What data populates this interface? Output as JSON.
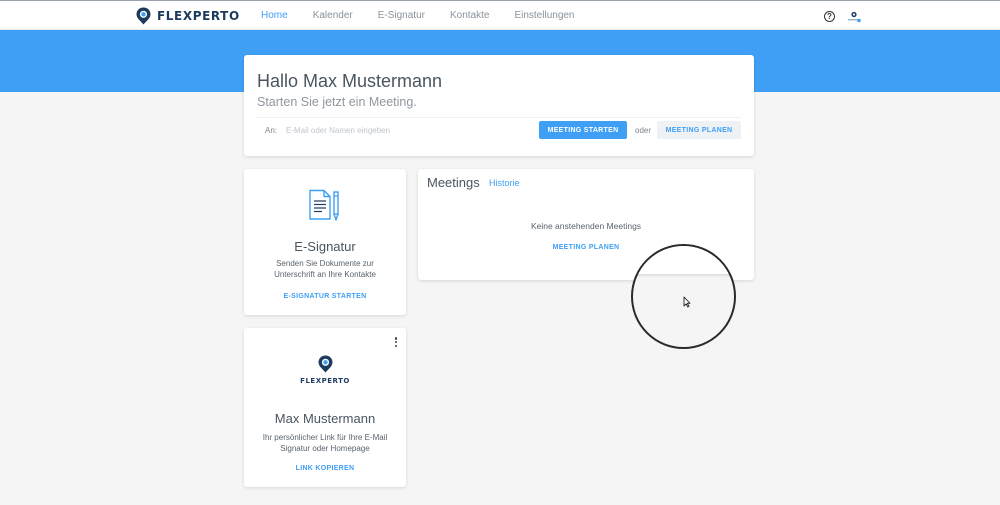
{
  "header": {
    "logo_text": "FLEXPERTO",
    "nav": [
      {
        "label": "Home",
        "active": true
      },
      {
        "label": "Kalender",
        "active": false
      },
      {
        "label": "E-Signatur",
        "active": false
      },
      {
        "label": "Kontakte",
        "active": false
      },
      {
        "label": "Einstellungen",
        "active": false
      }
    ],
    "help_icon": "question-circle-icon",
    "avatar_icon": "user-avatar-icon"
  },
  "welcome": {
    "greeting": "Hallo Max Mustermann",
    "subtitle": "Starten Sie jetzt ein Meeting.",
    "to_label": "An:",
    "input_value": "",
    "input_placeholder": "E-Mail oder Namen eingeben",
    "start_button": "MEETING STARTEN",
    "or_label": "oder",
    "plan_button": "MEETING PLANEN"
  },
  "esignature_card": {
    "icon": "document-pen-icon",
    "title": "E-Signatur",
    "description": "Senden Sie Dokumente zur Unterschrift an Ihre Kontakte",
    "action": "E-SIGNATUR STARTEN"
  },
  "meetings_card": {
    "title": "Meetings",
    "history_link": "Historie",
    "empty_text": "Keine anstehenden Meetings",
    "action": "MEETING PLANEN"
  },
  "profile_card": {
    "logo_text": "FLEXPERTO",
    "name": "Max Mustermann",
    "description": "Ihr persönlicher Link für Ihre E-Mail Signatur oder Homepage",
    "action": "LINK KOPIEREN",
    "menu_icon": "more-vertical-icon"
  },
  "colors": {
    "accent": "#3e9ff5",
    "brand_dark": "#1d3a5f",
    "background": "#f4f5f4"
  }
}
